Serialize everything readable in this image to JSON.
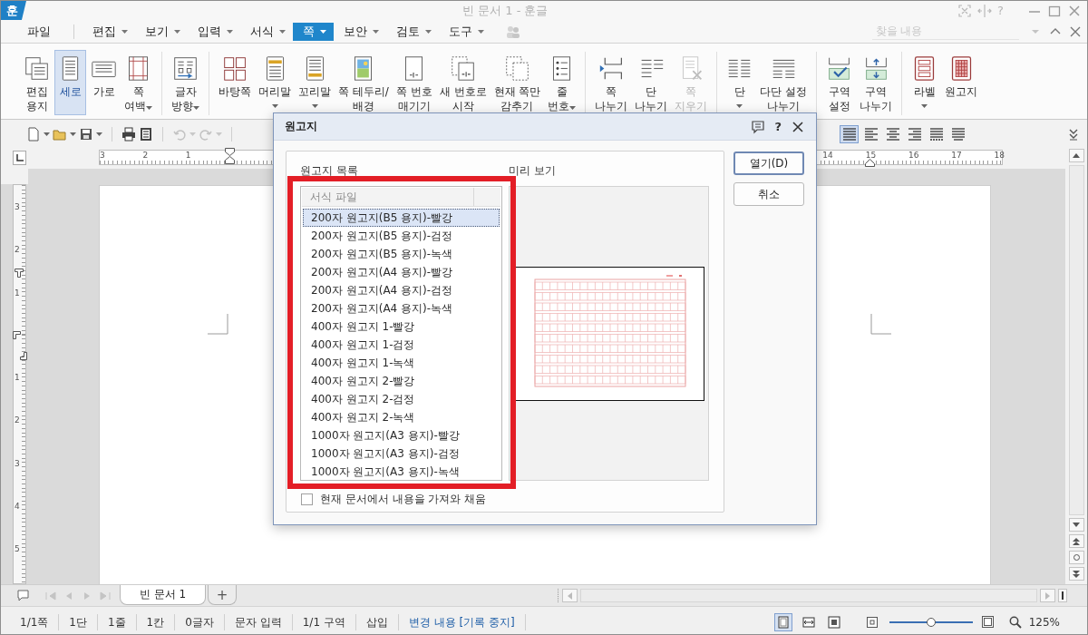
{
  "title_bar": {
    "logo": "훈",
    "title": "빈 문서 1 - 훈글",
    "help": "?"
  },
  "menu_bar": {
    "items": [
      {
        "label": "파일",
        "dropdown": false,
        "selected": false
      },
      {
        "label": "편집",
        "dropdown": true,
        "selected": false
      },
      {
        "label": "보기",
        "dropdown": true,
        "selected": false
      },
      {
        "label": "입력",
        "dropdown": true,
        "selected": false
      },
      {
        "label": "서식",
        "dropdown": true,
        "selected": false
      },
      {
        "label": "쪽",
        "dropdown": true,
        "selected": true
      },
      {
        "label": "보안",
        "dropdown": true,
        "selected": false
      },
      {
        "label": "검토",
        "dropdown": true,
        "selected": false
      },
      {
        "label": "도구",
        "dropdown": true,
        "selected": false
      }
    ],
    "search": {
      "placeholder": "찾을 내용"
    }
  },
  "ribbon": {
    "groups": [
      [
        {
          "lines": [
            "편집",
            "용지"
          ],
          "dropdown": false,
          "selected": false,
          "disabled": false
        },
        {
          "lines": [
            "세로"
          ],
          "dropdown": false,
          "selected": true,
          "disabled": false
        },
        {
          "lines": [
            "가로"
          ],
          "dropdown": false,
          "selected": false,
          "disabled": false
        },
        {
          "lines": [
            "쪽",
            "여백"
          ],
          "dropdown": true,
          "selected": false,
          "disabled": false
        }
      ],
      [
        {
          "lines": [
            "글자",
            "방향"
          ],
          "dropdown": true,
          "selected": false,
          "disabled": false
        }
      ],
      [
        {
          "lines": [
            "바탕쪽"
          ],
          "dropdown": false,
          "selected": false,
          "disabled": false
        },
        {
          "lines": [
            "머리말"
          ],
          "dropdown": true,
          "selected": false,
          "disabled": false
        },
        {
          "lines": [
            "꼬리말"
          ],
          "dropdown": true,
          "selected": false,
          "disabled": false
        },
        {
          "lines": [
            "쪽 테두리/",
            "배경"
          ],
          "dropdown": false,
          "selected": false,
          "disabled": false
        },
        {
          "lines": [
            "쪽 번호",
            "매기기"
          ],
          "dropdown": false,
          "selected": false,
          "disabled": false
        },
        {
          "lines": [
            "새 번호로",
            "시작"
          ],
          "dropdown": false,
          "selected": false,
          "disabled": false
        },
        {
          "lines": [
            "현재 쪽만",
            "감추기"
          ],
          "dropdown": false,
          "selected": false,
          "disabled": false
        },
        {
          "lines": [
            "줄",
            "번호"
          ],
          "dropdown": true,
          "selected": false,
          "disabled": false
        }
      ],
      [
        {
          "lines": [
            "쪽",
            "나누기"
          ],
          "dropdown": false,
          "selected": false,
          "disabled": false
        },
        {
          "lines": [
            "단",
            "나누기"
          ],
          "dropdown": false,
          "selected": false,
          "disabled": false
        },
        {
          "lines": [
            "쪽",
            "지우기"
          ],
          "dropdown": false,
          "selected": false,
          "disabled": true
        }
      ],
      [
        {
          "lines": [
            "단"
          ],
          "dropdown": true,
          "selected": false,
          "disabled": false
        },
        {
          "lines": [
            "다단 설정",
            "나누기"
          ],
          "dropdown": false,
          "selected": false,
          "disabled": false
        }
      ],
      [
        {
          "lines": [
            "구역",
            "설정"
          ],
          "dropdown": false,
          "selected": false,
          "disabled": false
        },
        {
          "lines": [
            "구역",
            "나누기"
          ],
          "dropdown": false,
          "selected": false,
          "disabled": false
        }
      ],
      [
        {
          "lines": [
            "라벨"
          ],
          "dropdown": true,
          "selected": false,
          "disabled": false
        },
        {
          "lines": [
            "원고지"
          ],
          "dropdown": false,
          "selected": false,
          "disabled": false
        }
      ]
    ]
  },
  "toolbar": {
    "history": [
      {
        "disabled": true
      },
      {
        "disabled": true
      }
    ],
    "alignment": [
      {
        "selected": true
      },
      {
        "selected": false
      },
      {
        "selected": false
      },
      {
        "selected": false
      },
      {
        "selected": false
      },
      {
        "selected": false
      }
    ]
  },
  "rulers": {
    "horizontal": {
      "left_labels": [
        "3",
        "2",
        "1"
      ],
      "right_labels": [
        "14",
        "15",
        "16",
        "17",
        "18"
      ]
    },
    "vertical": {
      "above": [
        "3",
        "2",
        "1"
      ],
      "below": [
        "1",
        "2",
        "3",
        "4",
        "5"
      ]
    }
  },
  "document_tabs": {
    "tabs": [
      {
        "label": "빈 문서 1",
        "selected": true
      }
    ],
    "add": "+"
  },
  "status_bar": {
    "items": [
      "1/1쪽",
      "1단",
      "1줄",
      "1칸",
      "0글자",
      "문자 입력",
      "1/1 구역",
      "삽입"
    ],
    "track_changes": "변경 내용 [기록 중지]",
    "views": [
      {
        "selected": true
      },
      {
        "selected": false
      },
      {
        "selected": false
      }
    ],
    "zoom": {
      "level": 0.5,
      "reading": "125%"
    }
  },
  "dialog": {
    "title": "원고지",
    "help": "?",
    "list_label": "원고지 목록",
    "preview_label": "미리 보기",
    "list_column": "서식 파일",
    "items": [
      {
        "label": "200자 원고지(B5 용지)-빨강",
        "selected": true
      },
      {
        "label": "200자 원고지(B5 용지)-검정",
        "selected": false
      },
      {
        "label": "200자 원고지(B5 용지)-녹색",
        "selected": false
      },
      {
        "label": "200자 원고지(A4 용지)-빨강",
        "selected": false
      },
      {
        "label": "200자 원고지(A4 용지)-검정",
        "selected": false
      },
      {
        "label": "200자 원고지(A4 용지)-녹색",
        "selected": false
      },
      {
        "label": "400자 원고지 1-빨강",
        "selected": false
      },
      {
        "label": "400자 원고지 1-검정",
        "selected": false
      },
      {
        "label": "400자 원고지 1-녹색",
        "selected": false
      },
      {
        "label": "400자 원고지 2-빨강",
        "selected": false
      },
      {
        "label": "400자 원고지 2-검정",
        "selected": false
      },
      {
        "label": "400자 원고지 2-녹색",
        "selected": false
      },
      {
        "label": "1000자 원고지(A3 용지)-빨강",
        "selected": false
      },
      {
        "label": "1000자 원고지(A3 용지)-검정",
        "selected": false
      },
      {
        "label": "1000자 원고지(A3 용지)-녹색",
        "selected": false
      }
    ],
    "checkbox": {
      "label": "현재 문서에서 내용을 가져와 채움",
      "checked": false
    },
    "buttons": [
      {
        "label": "열기(D)",
        "default": true
      },
      {
        "label": "취소",
        "default": false
      }
    ]
  }
}
